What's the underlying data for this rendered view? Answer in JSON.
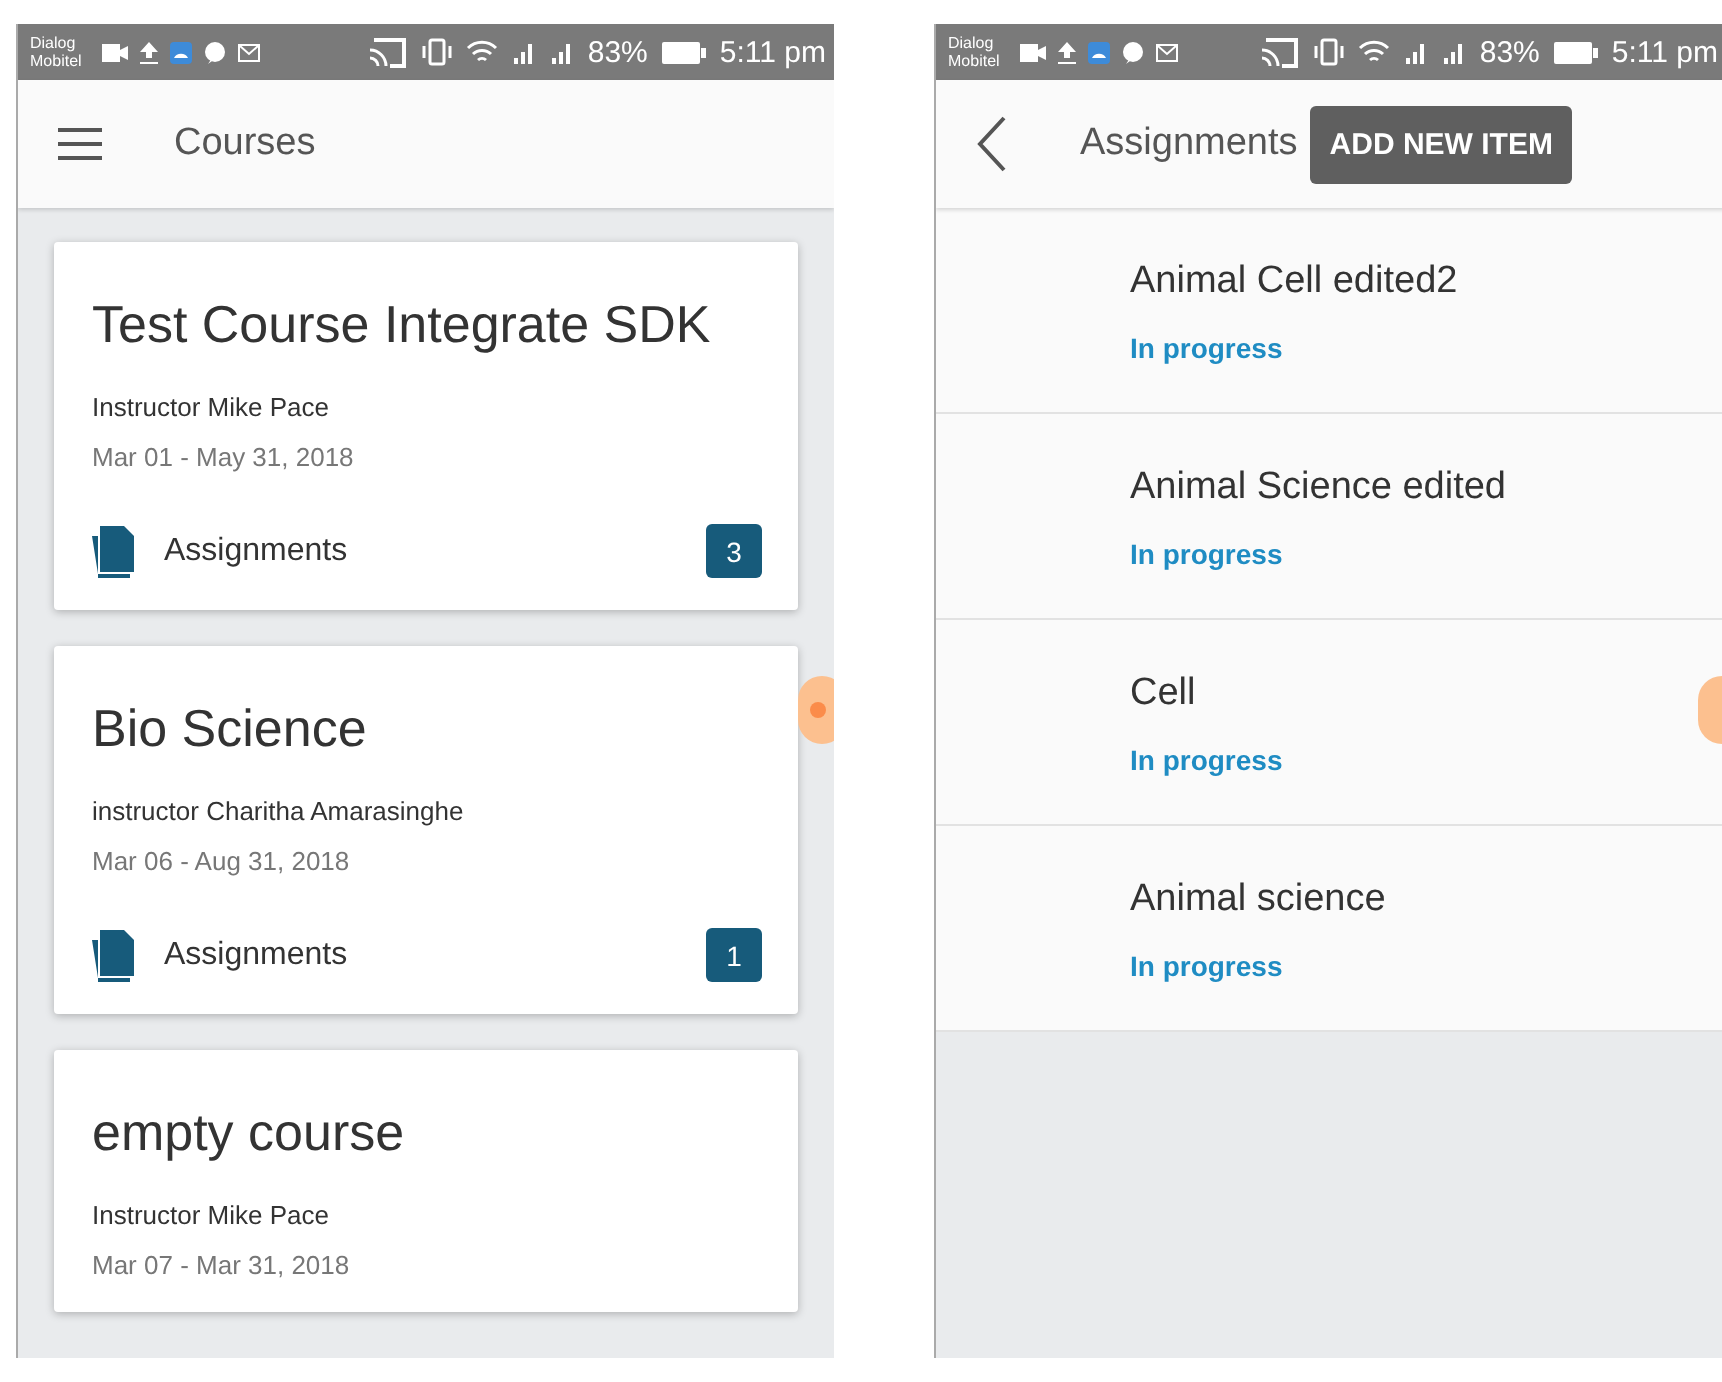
{
  "screens": [
    {
      "status_bar": {
        "carriers": [
          "Dialog",
          "Mobitel"
        ],
        "battery": "83%",
        "time": "5:11 pm"
      },
      "app_bar": {
        "nav": {
          "kind": "menu"
        },
        "title": "Courses"
      },
      "courses": [
        {
          "title": "Test Course Integrate SDK",
          "instructor": "Instructor Mike Pace",
          "dates": "Mar 01 - May 31, 2018",
          "link": "Assignments",
          "count": "3"
        },
        {
          "title": "Bio Science",
          "instructor": "instructor Charitha Amarasinghe",
          "dates": "Mar 06 - Aug 31, 2018",
          "link": "Assignments",
          "count": "1"
        },
        {
          "title": "empty course",
          "instructor": "Instructor Mike Pace",
          "dates": "Mar 07 - Mar 31, 2018"
        }
      ]
    },
    {
      "status_bar": {
        "carriers": [
          "Dialog",
          "Mobitel"
        ],
        "battery": "83%",
        "time": "5:11 pm"
      },
      "app_bar": {
        "nav": {
          "kind": "back"
        },
        "title": "Assignments",
        "action": "ADD NEW ITEM"
      },
      "assignments": [
        {
          "title": "Animal Cell edited2",
          "status": "In progress"
        },
        {
          "title": "Animal Science edited",
          "status": "In progress"
        },
        {
          "title": "Cell",
          "status": "In progress"
        },
        {
          "title": "Animal science",
          "status": "In progress"
        }
      ]
    }
  ]
}
